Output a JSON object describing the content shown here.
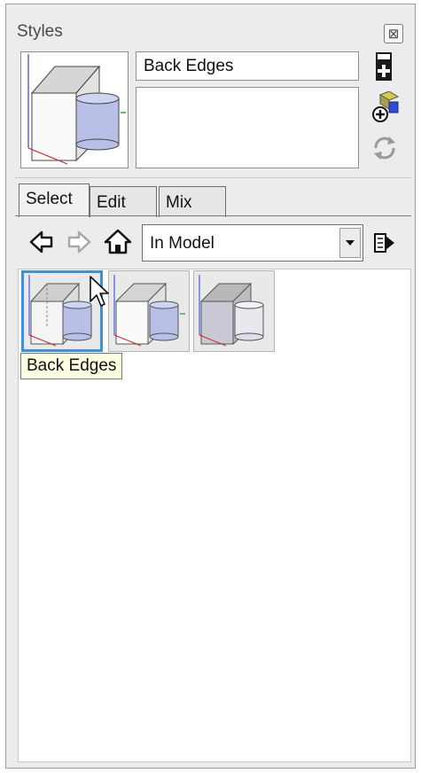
{
  "window": {
    "title": "Styles",
    "close_label": "⊠"
  },
  "style_info": {
    "name": "Back Edges",
    "description": ""
  },
  "tabs": [
    {
      "label": "Select",
      "active": true
    },
    {
      "label": "Edit",
      "active": false
    },
    {
      "label": "Mix",
      "active": false
    }
  ],
  "collection": {
    "selected": "In Model"
  },
  "styles": [
    {
      "name": "Back Edges",
      "selected": true
    },
    {
      "name": "",
      "selected": false
    },
    {
      "name": "",
      "selected": false
    }
  ],
  "tooltip": {
    "text": "Back Edges"
  },
  "icons": {
    "create_style": "create-style-icon",
    "update_style": "update-style-icon",
    "refresh": "refresh-icon",
    "back": "back-arrow-icon",
    "forward": "forward-arrow-icon",
    "home": "home-icon",
    "details": "details-icon",
    "dropdown": "chevron-down-icon",
    "cursor": "mouse-cursor-icon"
  },
  "colors": {
    "selection_border": "#3d8fe0",
    "tooltip_bg": "#ffffe1",
    "panel_bg": "#ececec"
  }
}
